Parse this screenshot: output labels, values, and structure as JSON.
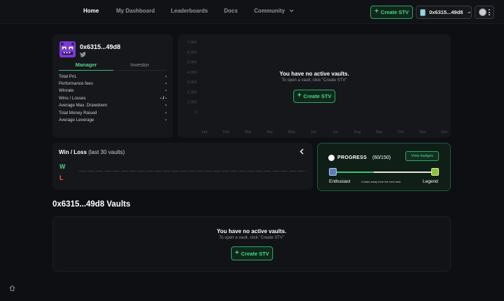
{
  "nav": {
    "links": [
      {
        "label": "Home",
        "active": true
      },
      {
        "label": "My Dashboard"
      },
      {
        "label": "Leaderboards"
      },
      {
        "label": "Docs"
      },
      {
        "label": "Community"
      }
    ],
    "create_label": "Create STV",
    "wallet_address": "0x6315...49d8"
  },
  "profile": {
    "name": "0x6315...49d8",
    "tabs": [
      "Manager",
      "Investor"
    ],
    "stats": [
      {
        "label": "Total PnL",
        "value": "-"
      },
      {
        "label": "Performance fees",
        "value": "-"
      },
      {
        "label": "Winrate",
        "value": "-"
      },
      {
        "label": "Wins / Losses",
        "value": "- / -"
      },
      {
        "label": "Average Max. Drawdown",
        "value": "-"
      },
      {
        "label": "Total Money Raised",
        "value": "-"
      },
      {
        "label": "Average Leverage",
        "value": "-"
      }
    ]
  },
  "chart_data": {
    "type": "line",
    "categories": [
      "Jan",
      "Feb",
      "Mar",
      "Apr",
      "May",
      "Jun",
      "Jul",
      "Aug",
      "Sep",
      "Oct",
      "Nov",
      "Dec"
    ],
    "y_ticks": [
      "7,000",
      "6,000",
      "5,000",
      "4,000",
      "3,000",
      "2,000",
      "1,000",
      "0"
    ],
    "ylim": [
      0,
      7000
    ],
    "series": [],
    "grid": false
  },
  "chart_empty": {
    "title": "You have no active vaults.",
    "subtitle": "To open a vault, click \"Create STV\"",
    "button": "Create STV"
  },
  "win_loss": {
    "title": "Win / Loss",
    "subtitle": "(last 30 vaults)",
    "win_label": "W",
    "loss_label": "L"
  },
  "progress": {
    "title": "PROGRESS",
    "count": "(60/150)",
    "view_badges": "View badges",
    "fraction": 0.4,
    "start_label": "Enthusiast",
    "middle_label": "4 tasks away from the next rank",
    "end_label": "Legend"
  },
  "vaults": {
    "title": "0x6315...49d8 Vaults",
    "empty_title": "You have no active vaults.",
    "empty_subtitle": "To open a vault, click \"Create STV\"",
    "button": "Create STV"
  },
  "colors": {
    "accent": "#48d88b",
    "win": "#4ad27f",
    "loss": "#ea5a4c",
    "background": "#0e0f12",
    "card": "#16171b"
  }
}
